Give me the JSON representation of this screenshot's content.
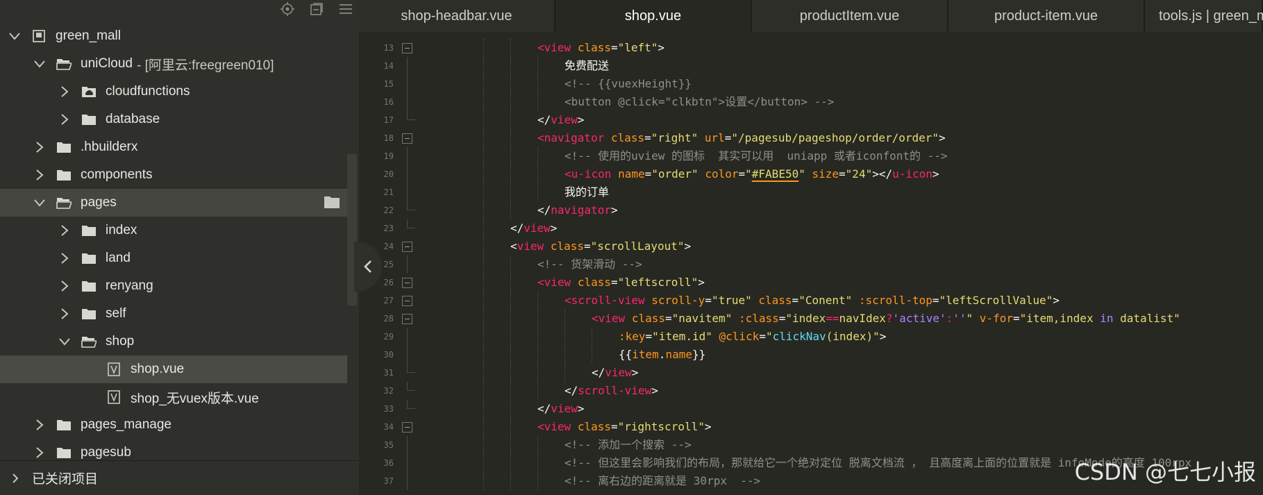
{
  "sidebar": {
    "tree": [
      {
        "label": "green_mall",
        "suffix": "",
        "chev": "down",
        "icon": "project-icon",
        "depth": 0
      },
      {
        "label": "uniCloud",
        "suffix": "- [阿里云:freegreen010]",
        "chev": "down",
        "icon": "cloud-folder-open-icon",
        "depth": 1
      },
      {
        "label": "cloudfunctions",
        "suffix": "",
        "chev": "right",
        "icon": "cloud-folder-icon",
        "depth": 2
      },
      {
        "label": "database",
        "suffix": "",
        "chev": "right",
        "icon": "folder-icon",
        "depth": 2
      },
      {
        "label": ".hbuilderx",
        "suffix": "",
        "chev": "right",
        "icon": "folder-icon",
        "depth": 1
      },
      {
        "label": "components",
        "suffix": "",
        "chev": "right",
        "icon": "folder-icon",
        "depth": 1
      },
      {
        "label": "pages",
        "suffix": "",
        "chev": "down",
        "icon": "folder-open-icon",
        "depth": 1,
        "state": "hl",
        "action": "folder-action-icon"
      },
      {
        "label": "index",
        "suffix": "",
        "chev": "right",
        "icon": "folder-icon",
        "depth": 2
      },
      {
        "label": "land",
        "suffix": "",
        "chev": "right",
        "icon": "folder-icon",
        "depth": 2
      },
      {
        "label": "renyang",
        "suffix": "",
        "chev": "right",
        "icon": "folder-icon",
        "depth": 2
      },
      {
        "label": "self",
        "suffix": "",
        "chev": "right",
        "icon": "folder-icon",
        "depth": 2
      },
      {
        "label": "shop",
        "suffix": "",
        "chev": "down",
        "icon": "folder-open-icon",
        "depth": 2
      },
      {
        "label": "shop.vue",
        "suffix": "",
        "chev": "none",
        "icon": "vue-file-icon",
        "depth": 3,
        "state": "sel"
      },
      {
        "label": "shop_无vuex版本.vue",
        "suffix": "",
        "chev": "none",
        "icon": "vue-file-icon",
        "depth": 3
      },
      {
        "label": "pages_manage",
        "suffix": "",
        "chev": "right",
        "icon": "folder-icon",
        "depth": 1
      },
      {
        "label": "pagesub",
        "suffix": "",
        "chev": "right",
        "icon": "folder-icon",
        "depth": 1
      }
    ],
    "closed_projects": "已关闭项目"
  },
  "tabs": [
    {
      "label": "shop-headbar.vue",
      "active": false
    },
    {
      "label": "shop.vue",
      "active": true
    },
    {
      "label": "productItem.vue",
      "active": false
    },
    {
      "label": "product-item.vue",
      "active": false
    },
    {
      "label": "tools.js | green_m",
      "active": false
    }
  ],
  "code": [
    {
      "n": "13",
      "fold": "open",
      "indent": 4,
      "parts": [
        [
          "t",
          "<view"
        ],
        [
          "p",
          " "
        ],
        [
          "a",
          "class"
        ],
        [
          "p",
          "="
        ],
        [
          "s",
          "\"left\""
        ],
        [
          "p",
          ">"
        ]
      ]
    },
    {
      "n": "14",
      "fold": "line",
      "indent": 5,
      "parts": [
        [
          "p",
          "免费配送"
        ]
      ]
    },
    {
      "n": "15",
      "fold": "line",
      "indent": 5,
      "parts": [
        [
          "c",
          "<!-- {{vuexHeight}}"
        ]
      ]
    },
    {
      "n": "16",
      "fold": "line",
      "indent": 5,
      "parts": [
        [
          "c",
          "<button @click=\"clkbtn\">设置</button> -->"
        ]
      ]
    },
    {
      "n": "17",
      "fold": "end",
      "indent": 4,
      "parts": [
        [
          "p",
          "</"
        ],
        [
          "t",
          "view"
        ],
        [
          "p",
          ">"
        ]
      ]
    },
    {
      "n": "18",
      "fold": "open",
      "indent": 4,
      "parts": [
        [
          "t",
          "<navigator"
        ],
        [
          "p",
          " "
        ],
        [
          "a",
          "class"
        ],
        [
          "p",
          "="
        ],
        [
          "s",
          "\"right\""
        ],
        [
          "p",
          " "
        ],
        [
          "a",
          "url"
        ],
        [
          "p",
          "="
        ],
        [
          "s",
          "\"/pagesub/pageshop/order/order\""
        ],
        [
          "p",
          ">"
        ]
      ]
    },
    {
      "n": "19",
      "fold": "line",
      "indent": 5,
      "parts": [
        [
          "c",
          "<!-- 使用的uview 的图标  其实可以用  uniapp 或者iconfont的 -->"
        ]
      ]
    },
    {
      "n": "20",
      "fold": "line",
      "indent": 5,
      "parts": [
        [
          "t",
          "<u-icon"
        ],
        [
          "p",
          " "
        ],
        [
          "a",
          "name"
        ],
        [
          "p",
          "="
        ],
        [
          "s",
          "\"order\""
        ],
        [
          "p",
          " "
        ],
        [
          "a",
          "color"
        ],
        [
          "p",
          "="
        ],
        [
          "s",
          "\""
        ],
        [
          "su",
          "#FABE50"
        ],
        [
          "s",
          "\""
        ],
        [
          "p",
          " "
        ],
        [
          "a",
          "size"
        ],
        [
          "p",
          "="
        ],
        [
          "s",
          "\"24\""
        ],
        [
          "p",
          "></"
        ],
        [
          "t",
          "u-icon"
        ],
        [
          "p",
          ">"
        ]
      ]
    },
    {
      "n": "21",
      "fold": "line",
      "indent": 5,
      "parts": [
        [
          "p",
          "我的订单"
        ]
      ]
    },
    {
      "n": "22",
      "fold": "end",
      "indent": 4,
      "parts": [
        [
          "p",
          "</"
        ],
        [
          "t",
          "navigator"
        ],
        [
          "p",
          ">"
        ]
      ]
    },
    {
      "n": "23",
      "fold": "end",
      "indent": 3,
      "parts": [
        [
          "p",
          "</"
        ],
        [
          "t",
          "view"
        ],
        [
          "p",
          ">"
        ]
      ]
    },
    {
      "n": "24",
      "fold": "open",
      "indent": 3,
      "parts": [
        [
          "p",
          "<"
        ],
        [
          "t",
          "view"
        ],
        [
          "p",
          " "
        ],
        [
          "a",
          "class"
        ],
        [
          "p",
          "="
        ],
        [
          "s",
          "\"scrollLayout\""
        ],
        [
          "p",
          ">"
        ]
      ]
    },
    {
      "n": "25",
      "fold": "line",
      "indent": 4,
      "parts": [
        [
          "c",
          "<!-- 货架滑动 -->"
        ]
      ]
    },
    {
      "n": "26",
      "fold": "open",
      "indent": 4,
      "parts": [
        [
          "t",
          "<view"
        ],
        [
          "p",
          " "
        ],
        [
          "a",
          "class"
        ],
        [
          "p",
          "="
        ],
        [
          "s",
          "\"leftscroll\""
        ],
        [
          "p",
          ">"
        ]
      ]
    },
    {
      "n": "27",
      "fold": "open",
      "indent": 5,
      "parts": [
        [
          "t",
          "<scroll-view"
        ],
        [
          "p",
          " "
        ],
        [
          "a",
          "scroll-y"
        ],
        [
          "p",
          "="
        ],
        [
          "s",
          "\"true\""
        ],
        [
          "p",
          " "
        ],
        [
          "a",
          "class"
        ],
        [
          "p",
          "="
        ],
        [
          "s",
          "\"Conent\""
        ],
        [
          "p",
          " "
        ],
        [
          "a",
          ":scroll-top"
        ],
        [
          "p",
          "="
        ],
        [
          "s",
          "\"leftScrollValue\""
        ],
        [
          "p",
          ">"
        ]
      ]
    },
    {
      "n": "28",
      "fold": "open",
      "indent": 6,
      "parts": [
        [
          "t",
          "<view"
        ],
        [
          "p",
          " "
        ],
        [
          "a",
          "class"
        ],
        [
          "p",
          "="
        ],
        [
          "s",
          "\"navitem\""
        ],
        [
          "p",
          " "
        ],
        [
          "a",
          ":class"
        ],
        [
          "p",
          "="
        ],
        [
          "s",
          "\"index"
        ],
        [
          "t",
          "=="
        ],
        [
          "s",
          "navIdex"
        ],
        [
          "t",
          "?"
        ],
        [
          "k",
          "'active'"
        ],
        [
          "t",
          ":"
        ],
        [
          "k",
          "''"
        ],
        [
          "s",
          "\""
        ],
        [
          "p",
          " "
        ],
        [
          "a",
          "v-for"
        ],
        [
          "p",
          "="
        ],
        [
          "s",
          "\"item,index "
        ],
        [
          "k",
          "in"
        ],
        [
          "s",
          " datalist\""
        ]
      ]
    },
    {
      "n": "29",
      "fold": "line",
      "indent": 7,
      "parts": [
        [
          "a",
          ":key"
        ],
        [
          "p",
          "="
        ],
        [
          "s",
          "\"item.id\""
        ],
        [
          "p",
          " "
        ],
        [
          "a",
          "@click"
        ],
        [
          "p",
          "="
        ],
        [
          "s",
          "\""
        ],
        [
          "f",
          "clickNav"
        ],
        [
          "s",
          "(index)\""
        ],
        [
          "p",
          ">"
        ]
      ]
    },
    {
      "n": "30",
      "fold": "line",
      "indent": 7,
      "parts": [
        [
          "p",
          "{{"
        ],
        [
          "a",
          "item"
        ],
        [
          "p",
          "."
        ],
        [
          "a",
          "name"
        ],
        [
          "p",
          "}}"
        ]
      ]
    },
    {
      "n": "31",
      "fold": "end",
      "indent": 6,
      "parts": [
        [
          "p",
          "</"
        ],
        [
          "t",
          "view"
        ],
        [
          "p",
          ">"
        ]
      ]
    },
    {
      "n": "32",
      "fold": "end",
      "indent": 5,
      "parts": [
        [
          "p",
          "</"
        ],
        [
          "t",
          "scroll-view"
        ],
        [
          "p",
          ">"
        ]
      ]
    },
    {
      "n": "33",
      "fold": "end",
      "indent": 4,
      "parts": [
        [
          "p",
          "</"
        ],
        [
          "t",
          "view"
        ],
        [
          "p",
          ">"
        ]
      ]
    },
    {
      "n": "34",
      "fold": "open",
      "indent": 4,
      "parts": [
        [
          "t",
          "<view"
        ],
        [
          "p",
          " "
        ],
        [
          "a",
          "class"
        ],
        [
          "p",
          "="
        ],
        [
          "s",
          "\"rightscroll\""
        ],
        [
          "p",
          ">"
        ]
      ]
    },
    {
      "n": "35",
      "fold": "line",
      "indent": 5,
      "parts": [
        [
          "c",
          "<!-- 添加一个搜索 -->"
        ]
      ]
    },
    {
      "n": "36",
      "fold": "line",
      "indent": 5,
      "parts": [
        [
          "c",
          "<!-- 但这里会影响我们的布局，那就给它一个绝对定位 脱离文档流 ， 且高度离上面的位置就是 infoMode的高度 100rpx"
        ]
      ]
    },
    {
      "n": "37",
      "fold": "line",
      "indent": 5,
      "parts": [
        [
          "c",
          "<!-- 离右边的距离就是 30rpx  -->"
        ]
      ]
    }
  ],
  "watermark": "CSDN @七七小报",
  "colors": {
    "bg_editor": "#272822",
    "bg_sidebar": "#2f302b",
    "tag": "#f92672",
    "attr": "#fd971f",
    "string": "#e6db74",
    "comment": "#8f908a",
    "func": "#66d9ef",
    "keyword": "#ae81ff"
  }
}
